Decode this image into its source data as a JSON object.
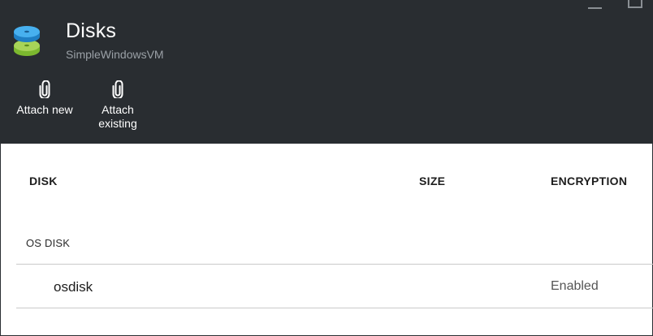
{
  "blade": {
    "title": "Disks",
    "subtitle": "SimpleWindowsVM",
    "icon": "disks-icon"
  },
  "commands": [
    {
      "label": "Attach new",
      "icon": "paperclip-icon"
    },
    {
      "label": "Attach\nexisting",
      "label_line1": "Attach",
      "label_line2": "existing",
      "icon": "paperclip-icon"
    }
  ],
  "table": {
    "columns": [
      "DISK",
      "SIZE",
      "ENCRYPTION"
    ],
    "sections": [
      {
        "label": "OS DISK",
        "rows": [
          {
            "disk": "osdisk",
            "size": "",
            "encryption": "Enabled"
          }
        ]
      }
    ]
  },
  "colors": {
    "header_bg": "#292d31",
    "accent_blue": "#2f9be0",
    "accent_green": "#8dc63f"
  }
}
